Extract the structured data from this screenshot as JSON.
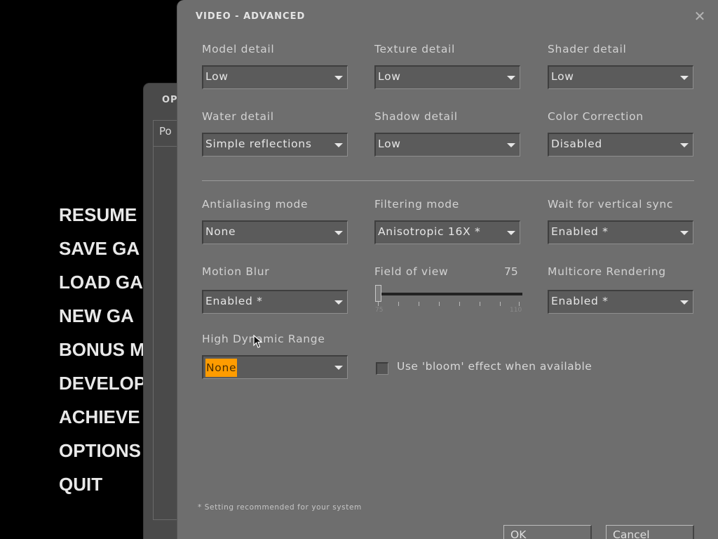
{
  "main_menu": {
    "items": [
      "RESUME",
      "SAVE GA",
      "LOAD GA",
      "NEW GA",
      "BONUS M",
      "DEVELOP",
      "ACHIEVE",
      "OPTIONS",
      "QUIT"
    ]
  },
  "options_window": {
    "title": "OP",
    "tab_label": "Po"
  },
  "dialog": {
    "title": "VIDEO - ADVANCED",
    "close_glyph": "✕",
    "settings": {
      "model_detail": {
        "label": "Model detail",
        "value": "Low"
      },
      "texture_detail": {
        "label": "Texture detail",
        "value": "Low"
      },
      "shader_detail": {
        "label": "Shader detail",
        "value": "Low"
      },
      "water_detail": {
        "label": "Water detail",
        "value": "Simple reflections"
      },
      "shadow_detail": {
        "label": "Shadow detail",
        "value": "Low"
      },
      "color_correction": {
        "label": "Color Correction",
        "value": "Disabled"
      },
      "antialiasing_mode": {
        "label": "Antialiasing mode",
        "value": "None"
      },
      "filtering_mode": {
        "label": "Filtering mode",
        "value": "Anisotropic 16X *"
      },
      "vsync": {
        "label": "Wait for vertical sync",
        "value": "Enabled *"
      },
      "motion_blur": {
        "label": "Motion Blur",
        "value": "Enabled *"
      },
      "field_of_view": {
        "label": "Field of view",
        "value": "75",
        "min": "75",
        "max": "110"
      },
      "multicore": {
        "label": "Multicore Rendering",
        "value": "Enabled *"
      },
      "hdr": {
        "label": "High Dynamic Range",
        "value": "None"
      }
    },
    "bloom": {
      "label": "Use 'bloom' effect when available",
      "checked": false
    },
    "footnote": "* Setting recommended for your system",
    "buttons": {
      "ok": "OK",
      "cancel": "Cancel"
    }
  },
  "colors": {
    "dialog_bg": "#6e6e6e",
    "highlight": "#ff9c00",
    "menu_text": "#e8e8e8"
  }
}
